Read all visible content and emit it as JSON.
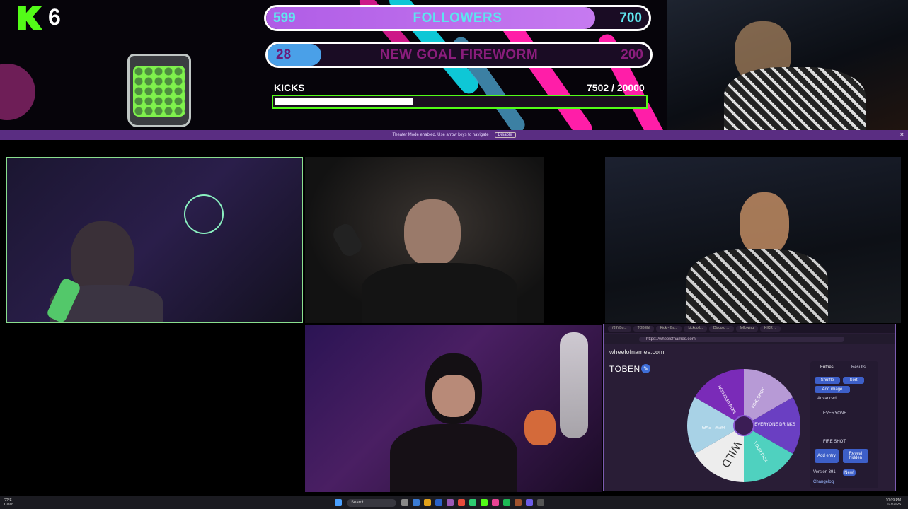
{
  "overlay": {
    "kick_count": "6",
    "followers": {
      "current": "599",
      "title": "FOLLOWERS",
      "goal": "700",
      "progress": 0.86
    },
    "fireworm": {
      "current": "28",
      "title": "NEW GOAL FIREWORM",
      "goal": "200",
      "progress": 0.14
    },
    "kicks": {
      "label": "KICKS",
      "value": "7502  / 20000",
      "progress": 0.375
    }
  },
  "banner": {
    "text": "Theater Mode enabled. Use arrow keys to navigate",
    "button": "Disable",
    "close": "×"
  },
  "tiles": [
    "streamer-cam-1",
    "streamer-cam-2",
    "streamer-cam-3",
    "streamer-cam-4"
  ],
  "browser": {
    "tabs": [
      "(89) Bo...",
      "TOBEN",
      "Kick - Ga...",
      "kickdoll...",
      "Discord ...",
      "following",
      "KICK ..."
    ],
    "url": "https://wheelofnames.com",
    "site": "wheelofnames.com",
    "wheel_title": "TOBEN",
    "slices": [
      "FIRE SHOT",
      "EVERYONE DRINKS",
      "YOUR PICK",
      "WILD",
      "NEW LEVEL",
      "NEW DECISION"
    ],
    "panel": {
      "entries": "Entries",
      "results": "Results",
      "shuffle": "Shuffle",
      "sort": "Sort",
      "add_image": "Add image",
      "advanced": "Advanced",
      "item1": "EVERYONE",
      "item2": "FIRE SHOT",
      "add_entry": "Add entry",
      "reveal_hidden": "Reveal hidden",
      "version": "Version 391",
      "new_badge": "New!",
      "changelog": "Changelog"
    }
  },
  "taskbar": {
    "search": "Search",
    "weather": "??°F\nClear",
    "clock": "10:09 PM\n1/7/2025"
  },
  "colors": {
    "kick_green": "#53fc18",
    "purple": "#5a2d82",
    "followers_fill": "#b562e8"
  }
}
